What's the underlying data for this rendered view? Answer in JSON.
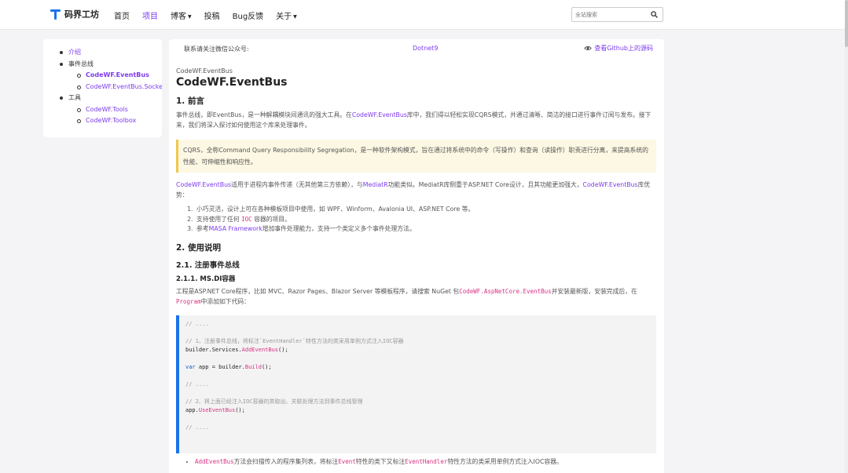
{
  "nav": {
    "logo_text": "码界工坊",
    "items": [
      {
        "label": "首页",
        "dropdown": false,
        "active": false
      },
      {
        "label": "项目",
        "dropdown": false,
        "active": true
      },
      {
        "label": "博客",
        "dropdown": true,
        "active": false
      },
      {
        "label": "投稿",
        "dropdown": false,
        "active": false
      },
      {
        "label": "Bug反馈",
        "dropdown": false,
        "active": false
      },
      {
        "label": "关于",
        "dropdown": true,
        "active": false
      }
    ],
    "search_placeholder": "全站搜索",
    "search_icon": "search-icon"
  },
  "toc": {
    "items": [
      {
        "label": "介绍",
        "link": true,
        "current": false,
        "children": []
      },
      {
        "label": "事件总线",
        "link": false,
        "current": false,
        "children": [
          {
            "label": "CodeWF.EventBus",
            "current": true
          },
          {
            "label": "CodeWF.EventBus.Socket",
            "current": false
          }
        ]
      },
      {
        "label": "工具",
        "link": false,
        "current": false,
        "children": [
          {
            "label": "CodeWF.Tools",
            "current": false
          },
          {
            "label": "CodeWF.Toolbox",
            "current": false
          }
        ]
      }
    ]
  },
  "topbar": {
    "follow_text": "联系请关注微信公众号:",
    "account": "Dotnet9",
    "github_text": "查看Github上的源码"
  },
  "article": {
    "crumb": "CodeWF.EventBus",
    "title": "CodeWF.EventBus",
    "h_intro": "1. 前言",
    "intro_1": "事件总线，即EventBus，是一种解耦模块间通讯的强大工具。在",
    "intro_link": "CodeWF.EventBus",
    "intro_2": "库中，我们得以轻松实现CQRS模式，并通过清晰、简洁的接口进行事件订阅与发布。接下来，我们将深入探讨如何使用这个库来处理事件。",
    "quote": "CQRS，全称Command Query Responsibility Segregation，是一种软件架构模式，旨在通过将系统中的命令（写操作）和查询（读操作）职责进行分离，来提高系统的性能、可伸缩性和响应性。",
    "p2_link1": "CodeWF.EventBus",
    "p2_a": "适用于进程内事件传递（无其他第三方依赖），与",
    "p2_link2": "MediatR",
    "p2_b": "功能类似。MediatR库侧重于ASP.NET Core设计，且其功能更加强大，",
    "p2_link3": "CodeWF.EventBus",
    "p2_c": "库优势：",
    "features": [
      {
        "text": "小巧灵活，设计上可在各种模板项目中使用，如 WPF、Winform、Avalonia UI、ASP.NET Core 等。",
        "code": "",
        "link": ""
      },
      {
        "text_a": "支持使用了任何",
        "code": "IOC",
        "text_b": "容器的项目。"
      },
      {
        "text_a": "参考",
        "link": "MASA Framework",
        "text_b": "增加事件处理能力，支持一个类定义多个事件处理方法。"
      }
    ],
    "h_usage": "2. 使用说明",
    "h_reg": "2.1. 注册事件总线",
    "h_msdi": "2.1.1. MS.DI容器",
    "p3_a": "工程是ASP.NET Core程序，比如 MVC、Razor Pages、Blazor Server 等模板程序，请搜索 NuGet 包",
    "p3_code1": "CodeWF.AspNetCore.EventBus",
    "p3_b": "并安装最新版，安装完成后，在",
    "p3_code2": "Program",
    "p3_c": "中添加如下代码：",
    "code": {
      "line1": "// ....",
      "line2": "// 1、注册事件总线，将标注`EventHandler`特性方法的类采用单例方式注入IOC容器",
      "line3_a": "builder.Services.",
      "line3_fn": "AddEventBus",
      "line3_b": "();",
      "line4_kw": "var",
      "line4_a": " app = builder.",
      "line4_fn": "Build",
      "line4_b": "();",
      "line5": "// ....",
      "line6": "// 2、将上面已经注入IOC容器的类取出、关联处理方法到事件总线管理",
      "line7_a": "app.",
      "line7_fn": "UseEventBus",
      "line7_b": "();",
      "line8": "// ...."
    },
    "bullet_code1": "AddEventBus",
    "bullet_a": "方法会扫描传入的程序集列表，将标注",
    "bullet_code2": "Event",
    "bullet_b": "特性的类下又标注",
    "bullet_code3": "EventHandler",
    "bullet_c": "特性方法的类采用单例方式注入IOC容器。"
  }
}
